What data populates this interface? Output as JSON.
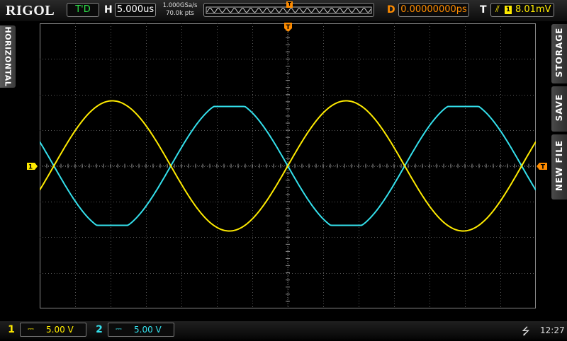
{
  "header": {
    "brand": "RIGOL",
    "run_status": "T'D",
    "h_label": "H",
    "timebase": "5.000us",
    "sample_rate": "1.000GSa/s",
    "memory_depth": "70.0k pts",
    "memory_trigger_marker": "T",
    "delay_label": "D",
    "delay_value": "0.00000000ps",
    "trigger_label": "T",
    "trigger_source": "1",
    "trigger_edge_icon": "rising-edge-icon",
    "trigger_level": "8.01mV"
  },
  "side_tabs": {
    "left": "HORIZONTAL",
    "right": [
      "STORAGE",
      "SAVE",
      "NEW FILE"
    ]
  },
  "display": {
    "ch1_marker": "1",
    "trigger_pos_marker": "T",
    "trigger_level_marker": "T",
    "grid_divisions": {
      "x": 14,
      "y": 8
    },
    "colors": {
      "ch1": "#ffeb00",
      "ch2": "#34e0ec",
      "trigger": "#ff8c00",
      "grid": "#5a5a5a"
    }
  },
  "channels": [
    {
      "number": "1",
      "coupling_icon": "dc-coupling-icon",
      "coupling_glyph": "⎓",
      "scale": "5.00 V"
    },
    {
      "number": "2",
      "coupling_icon": "dc-coupling-icon",
      "coupling_glyph": "⎓",
      "scale": "5.00 V"
    }
  ],
  "footer": {
    "usb_icon": "usb-icon",
    "usb_glyph": "⭍",
    "time": "12:27"
  }
}
